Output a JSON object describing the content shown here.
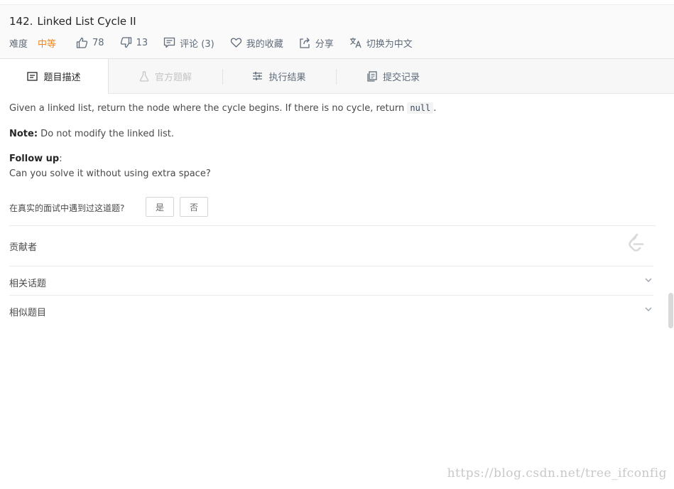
{
  "problem": {
    "number": "142.",
    "title": "Linked List Cycle II",
    "difficulty_label": "难度",
    "difficulty_value": "中等",
    "likes": "78",
    "dislikes": "13",
    "comments": "评论 (3)",
    "favorite": "我的收藏",
    "share": "分享",
    "switch_lang": "切换为中文"
  },
  "tabs": [
    {
      "label": "题目描述",
      "icon": "description-icon"
    },
    {
      "label": "官方题解",
      "icon": "flask-icon"
    },
    {
      "label": "执行结果",
      "icon": "sliders-icon"
    },
    {
      "label": "提交记录",
      "icon": "records-icon"
    }
  ],
  "description": {
    "line1_text": "Given a linked list, return the node where the cycle begins. If there is no cycle, return ",
    "line1_code": "null",
    "line1_end": ".",
    "note_label": "Note:",
    "note_text": " Do not modify the linked list.",
    "followup_label": "Follow up",
    "followup_colon": ":",
    "followup_text": "Can you solve it without using extra space?"
  },
  "interview": {
    "question": "在真实的面试中遇到过这道题?",
    "yes": "是",
    "no": "否"
  },
  "sections": {
    "contributors": "贡献者",
    "related_topics": "相关话题",
    "similar_problems": "相似题目"
  },
  "watermark": "https://blog.csdn.net/tree_ifconfig",
  "colors": {
    "difficulty_medium": "#f0861e"
  }
}
